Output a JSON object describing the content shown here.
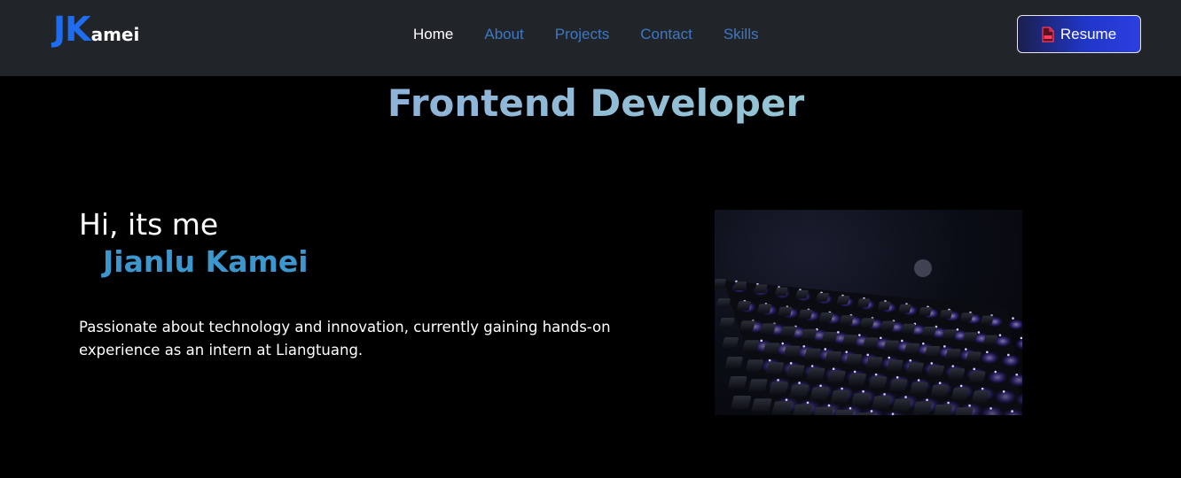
{
  "brand": {
    "mark": "JK",
    "rest": "amei"
  },
  "nav": {
    "items": [
      {
        "label": "Home",
        "active": true
      },
      {
        "label": "About",
        "active": false
      },
      {
        "label": "Projects",
        "active": false
      },
      {
        "label": "Contact",
        "active": false
      },
      {
        "label": "Skills",
        "active": false
      }
    ],
    "resume_label": "Resume",
    "resume_icon": "pdf-file-icon"
  },
  "hero": {
    "title": "Frontend Developer",
    "greeting": "Hi, its me",
    "name": "Jianlu Kamei",
    "bio": "Passionate about technology and innovation, currently gaining hands-on experience as an intern at Liangtuang."
  },
  "colors": {
    "navbar_bg": "#212529",
    "page_bg": "#000000",
    "brand_accent": "#1e6df0",
    "nav_link": "#3d78c4",
    "name_color": "#3d97cf",
    "keyboard_glow": "#7b5cff"
  }
}
